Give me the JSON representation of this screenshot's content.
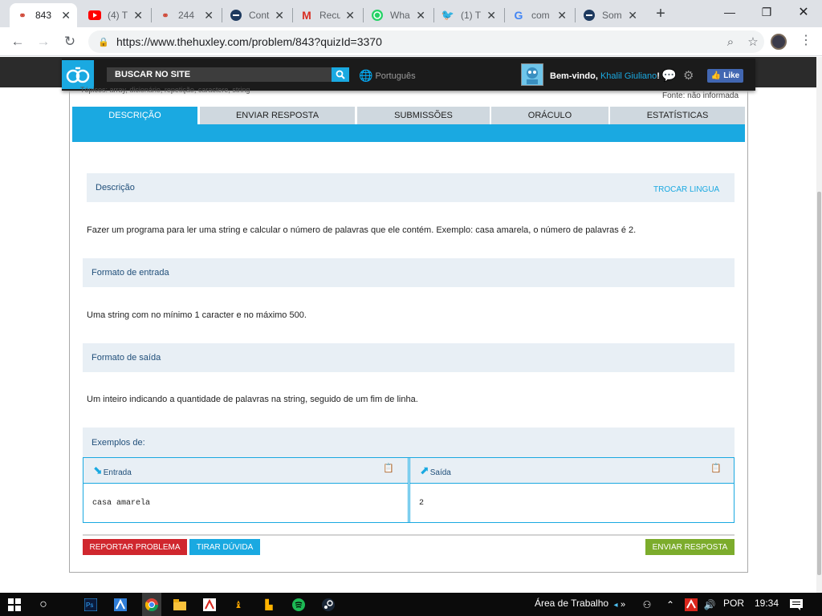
{
  "browser": {
    "tabs": [
      {
        "title": "843",
        "active": true
      },
      {
        "title": "(4) T"
      },
      {
        "title": "244"
      },
      {
        "title": "Cont"
      },
      {
        "title": "Recu"
      },
      {
        "title": "Wha"
      },
      {
        "title": "(1) T"
      },
      {
        "title": "com"
      },
      {
        "title": "Som"
      }
    ],
    "url": "https://www.thehuxley.com/problem/843?quizId=3370"
  },
  "site": {
    "search_label": "BUSCAR NO SITE",
    "language": "Português",
    "welcome": "Bem-vindo,",
    "username": "Khalil Giuliano",
    "welcome_end": "!",
    "like": "Like",
    "topics": "Tópicos: array, dicionário, repetição, caractere, string",
    "fonte": "Fonte: não informada"
  },
  "problem_tabs": [
    "DESCRIÇÃO",
    "ENVIAR RESPOSTA",
    "SUBMISSÕES",
    "ORÁCULO",
    "ESTATÍSTICAS"
  ],
  "sections": {
    "descricao_title": "Descrição",
    "trocar_lingua": "TROCAR LINGUA",
    "descricao_text": "Fazer um programa para ler uma string e calcular o número de palavras que ele contém. Exemplo: casa amarela, o número de palavras é 2.",
    "entrada_title": "Formato de entrada",
    "entrada_text": "Uma string com no mínimo 1 caracter e no máximo 500.",
    "saida_title": "Formato de saída",
    "saida_text": "Um inteiro indicando a quantidade de palavras na string, seguido de um fim de linha.",
    "exemplos_title": "Exemplos de:"
  },
  "example": {
    "input_label": "Entrada",
    "output_label": "Saída",
    "input": "casa amarela",
    "output": "2"
  },
  "buttons": {
    "report": "REPORTAR PROBLEMA",
    "doubt": "TIRAR DÚVIDA",
    "submit": "ENVIAR RESPOSTA"
  },
  "colors": {
    "accent": "#1aa9e1",
    "report": "#d0272e",
    "submit": "#7cac2c"
  },
  "taskbar": {
    "desktop_label": "Área de Trabalho",
    "language": "POR",
    "time": "19:34"
  }
}
